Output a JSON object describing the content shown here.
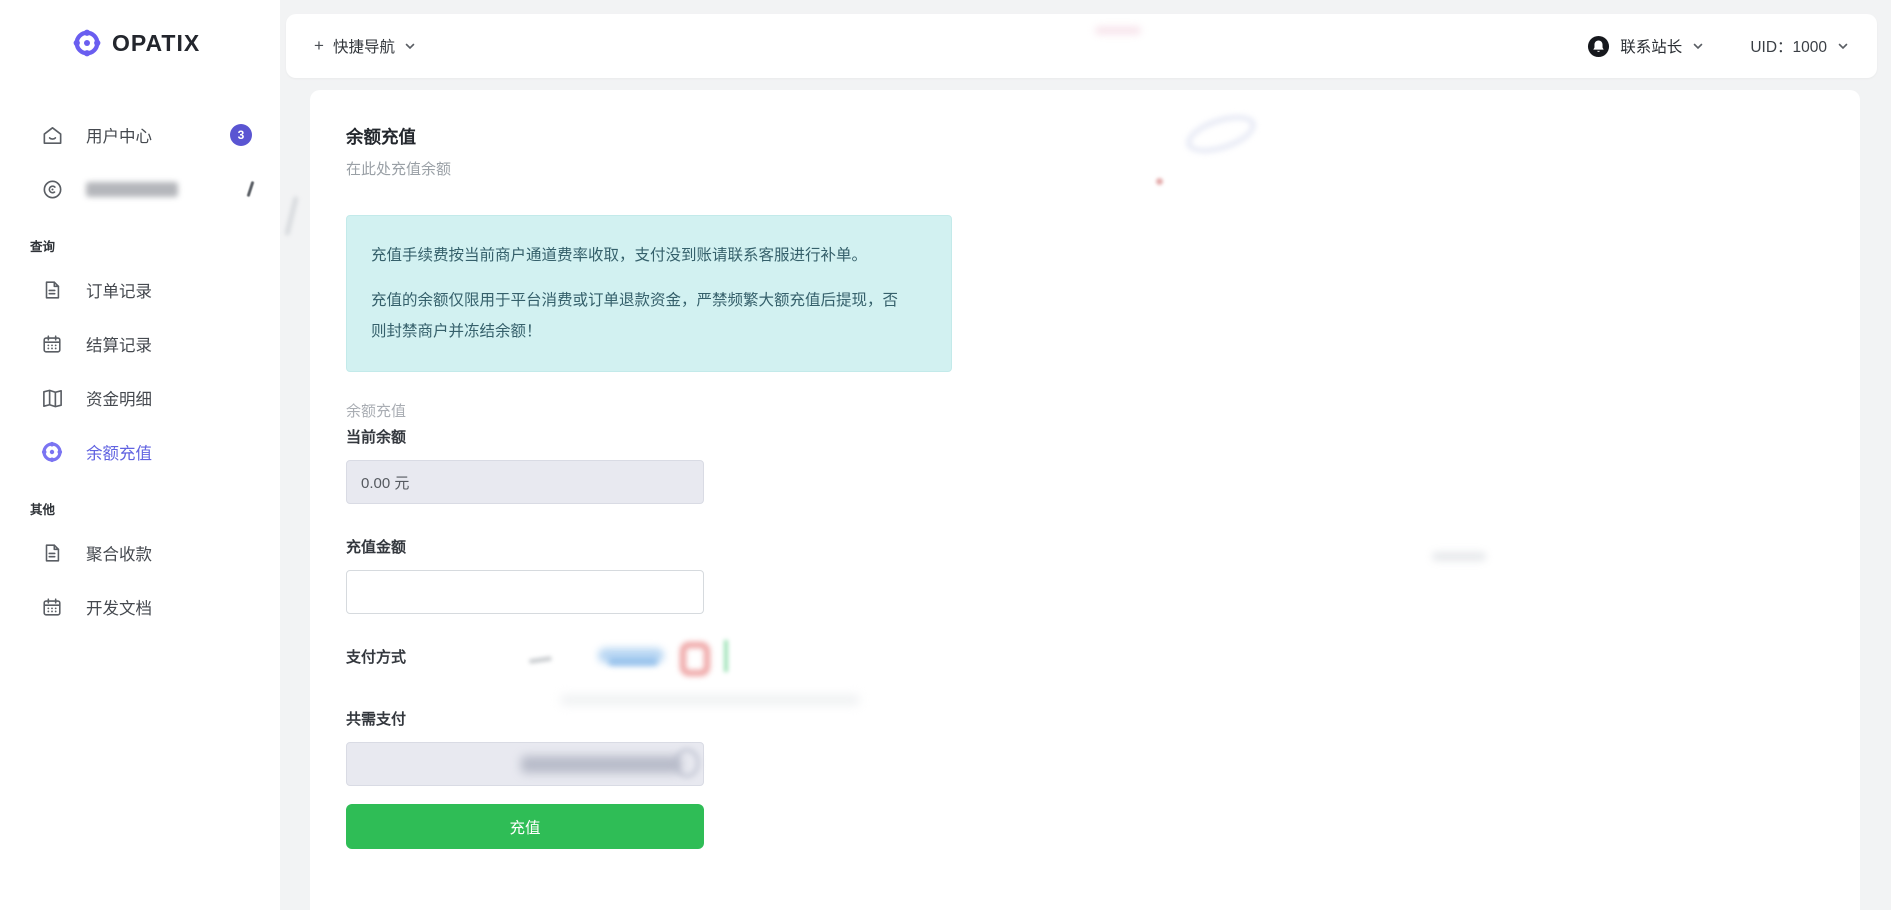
{
  "brand": {
    "name": "OPATIX"
  },
  "colors": {
    "accent": "#6a5ef0",
    "active_link": "#6163e1",
    "success": "#2fbd56",
    "alert_bg": "#d2f1f1",
    "alert_text": "#35606b",
    "badge_bg": "#5a55d2"
  },
  "topbar": {
    "quick_nav_plus": "+",
    "quick_nav_label": "快捷导航",
    "contact_label": "联系站长",
    "uid_label": "UID：1000"
  },
  "sidebar": {
    "top_items": [
      {
        "label": "用户中心",
        "icon": "home-icon",
        "badge": "3"
      },
      {
        "label": "",
        "icon": "compass-icon",
        "blurred": true
      }
    ],
    "sections": [
      {
        "title": "查询",
        "items": [
          {
            "label": "订单记录",
            "icon": "document-icon"
          },
          {
            "label": "结算记录",
            "icon": "calendar-icon"
          },
          {
            "label": "资金明细",
            "icon": "ledger-book-icon"
          },
          {
            "label": "余额充值",
            "icon": "chip-icon",
            "active": true
          }
        ]
      },
      {
        "title": "其他",
        "items": [
          {
            "label": "聚合收款",
            "icon": "document-icon"
          },
          {
            "label": "开发文档",
            "icon": "calendar-icon"
          }
        ]
      }
    ]
  },
  "main": {
    "title": "余额充值",
    "subtitle": "在此处充值余额",
    "alert": {
      "line1": "充值手续费按当前商户通道费率收取，支付没到账请联系客服进行补单。",
      "line2": "充值的余额仅限用于平台消费或订单退款资金，严禁频繁大额充值后提现，否则封禁商户并冻结余额！"
    },
    "form": {
      "group_label": "余额充值",
      "current_balance_label": "当前余额",
      "current_balance_value": "0.00 元",
      "amount_label": "充值金额",
      "amount_value": "",
      "payment_method_label": "支付方式",
      "total_label": "共需支付",
      "submit_label": "充值"
    }
  }
}
